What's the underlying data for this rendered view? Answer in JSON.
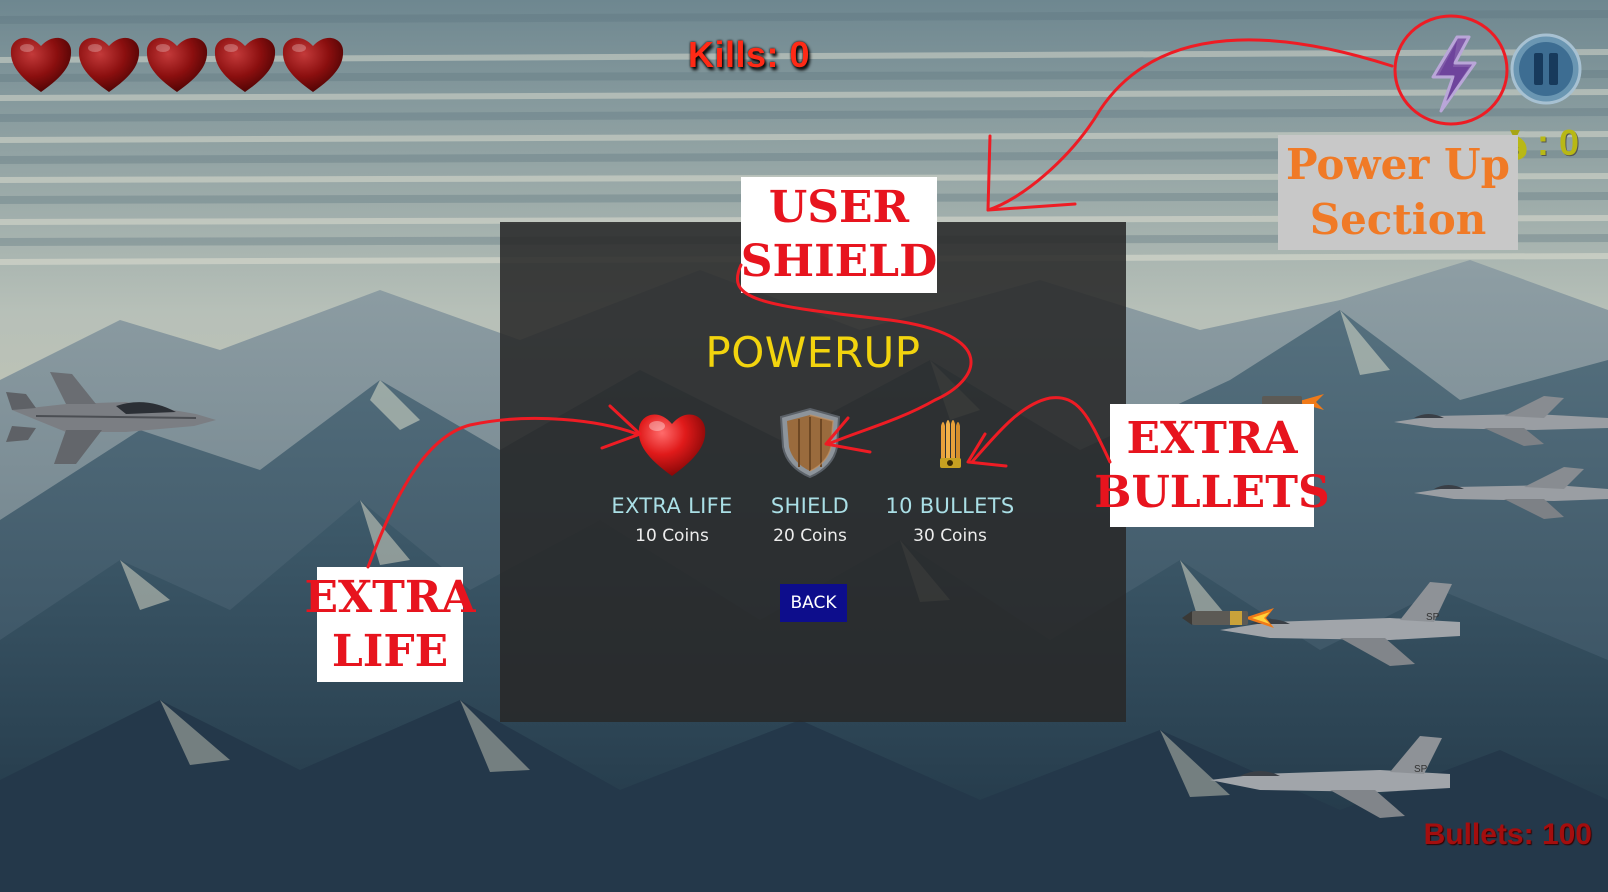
{
  "hud": {
    "lives": 5,
    "kills_label": "Kills: 0",
    "coins_value": ": 0",
    "bullets_label": "Bullets: 100"
  },
  "icons": {
    "hearts": "heart-icon",
    "power_up": "lightning-bolt-icon",
    "pause": "pause-icon",
    "coins": "money-bag-icon"
  },
  "modal": {
    "title": "POWERUP",
    "items": [
      {
        "name": "EXTRA LIFE",
        "cost": "10 Coins",
        "icon": "heart-icon"
      },
      {
        "name": "SHIELD",
        "cost": "20 Coins",
        "icon": "shield-icon"
      },
      {
        "name": "10 BULLETS",
        "cost": "30 Coins",
        "icon": "bullet-icon"
      }
    ],
    "back_label": "BACK"
  },
  "callouts": {
    "user_shield": [
      "USER",
      "SHIELD"
    ],
    "power_up_section": [
      "Power Up",
      "Section"
    ],
    "extra_bullets": [
      "EXTRA",
      "BULLETS"
    ],
    "extra_life": [
      "EXTRA",
      "LIFE"
    ]
  },
  "colors": {
    "kills": "#ff2a16",
    "modal_title": "#f2d40e",
    "item_name": "#aadfe6",
    "back_button": "#0d0d8c",
    "callout_text": "#e7141e",
    "annotation": "#ee1c24",
    "bullets": "#a40e0e",
    "coins": "#b8b815"
  }
}
